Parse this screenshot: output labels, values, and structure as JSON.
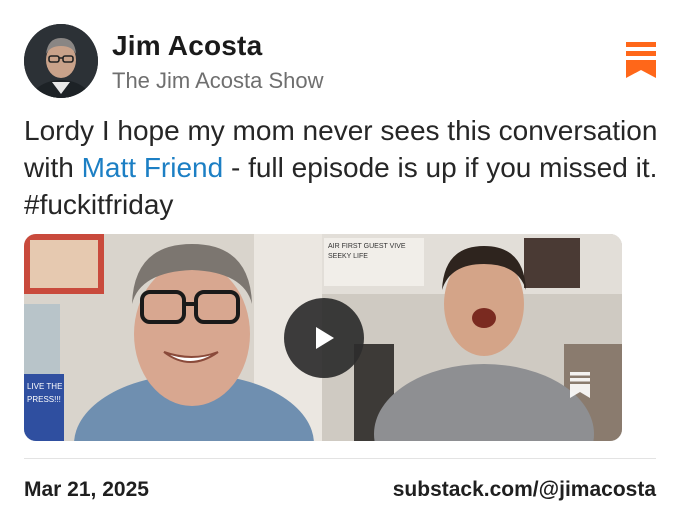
{
  "post": {
    "author_name": "Jim Acosta",
    "publication_name": "The Jim Acosta Show",
    "text_before": "Lordy I hope my mom never sees this conversation with ",
    "mention": "Matt Friend",
    "text_after": " - full episode is up if you missed it. #fuckitfriday",
    "date": "Mar 21, 2025",
    "source_link": "substack.com/@jimacosta"
  },
  "video": {
    "sign_text": "LIVE THE PRESS!!!",
    "poster_text": "AIR FIRST GUEST VIVE SEEKY LIFE"
  },
  "colors": {
    "brand": "#ff6719",
    "mention": "#1c7fc4"
  },
  "icons": {
    "bookmark": "substack-bookmark-icon",
    "play": "play-icon"
  }
}
